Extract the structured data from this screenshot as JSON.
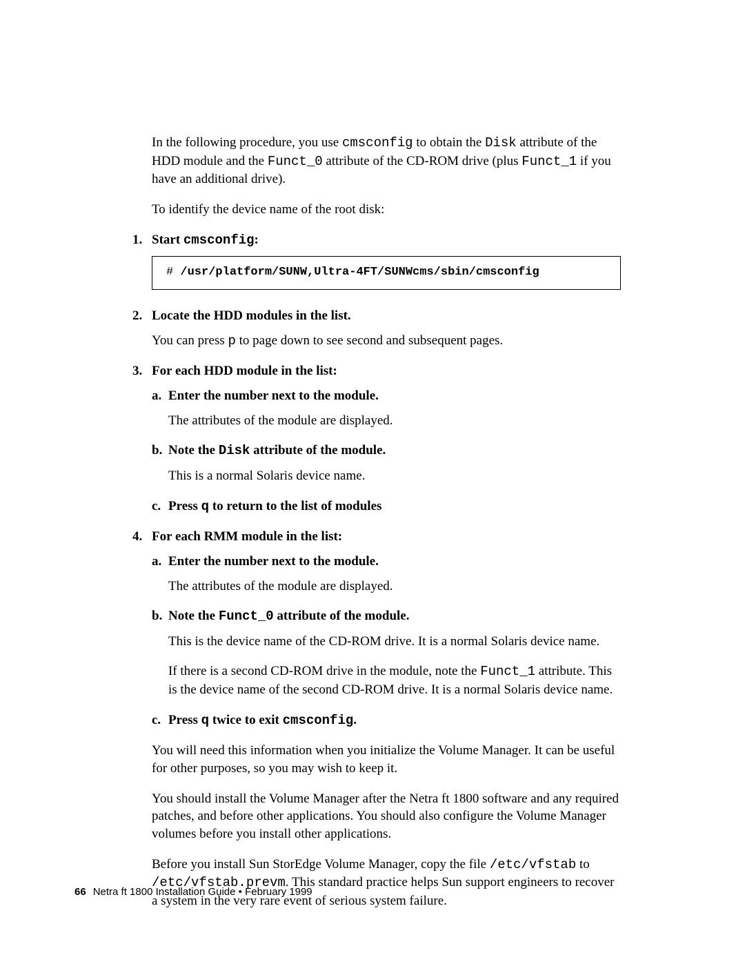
{
  "intro": {
    "p1a": "In the following procedure, you use ",
    "p1_code1": "cmsconfig",
    "p1b": " to obtain the ",
    "p1_code2": "Disk",
    "p1c": " attribute of the HDD module and the ",
    "p1_code3": "Funct_0",
    "p1d": " attribute of the CD-ROM drive (plus ",
    "p1_code4": "Funct_1",
    "p1e": " if you have an additional drive).",
    "p2": "To identify the device name of the root disk:"
  },
  "step1": {
    "num": "1.",
    "label_a": "Start ",
    "label_code": "cmsconfig",
    "label_b": ":"
  },
  "codebox": {
    "prompt": "# ",
    "cmd": "/usr/platform/SUNW,Ultra-4FT/SUNWcms/sbin/cmsconfig"
  },
  "step2": {
    "num": "2.",
    "label": "Locate the HDD modules in the list.",
    "p_a": "You can press ",
    "p_code": "p",
    "p_b": " to page down to see second and subsequent pages."
  },
  "step3": {
    "num": "3.",
    "label": "For each HDD module in the list:",
    "a": {
      "num": "a.",
      "label": "Enter the number next to the module.",
      "p": "The attributes of the module are displayed."
    },
    "b": {
      "num": "b.",
      "label_a": "Note the ",
      "label_code": "Disk",
      "label_b": " attribute of the module.",
      "p": "This is a normal Solaris device name."
    },
    "c": {
      "num": "c.",
      "label_a": "Press ",
      "label_code": "q",
      "label_b": " to return to the list of modules"
    }
  },
  "step4": {
    "num": "4.",
    "label": "For each RMM module in the list:",
    "a": {
      "num": "a.",
      "label": "Enter the number next to the module.",
      "p": "The attributes of the module are displayed."
    },
    "b": {
      "num": "b.",
      "label_a": "Note the ",
      "label_code": "Funct_0",
      "label_b": " attribute of the module.",
      "p1": "This is the device name of the CD-ROM drive. It is a normal Solaris device name.",
      "p2_a": "If there is a second CD-ROM drive in the module, note the ",
      "p2_code": "Funct_1",
      "p2_b": " attribute. This is the device name of the second CD-ROM drive. It is a normal Solaris device name."
    },
    "c": {
      "num": "c.",
      "label_a": "Press ",
      "label_code1": "q",
      "label_b": " twice to exit ",
      "label_code2": "cmsconfig",
      "label_c": "."
    }
  },
  "closing": {
    "p1": "You will need this information when you initialize the Volume Manager. It can be useful for other purposes, so you may wish to keep it.",
    "p2": "You should install the Volume Manager after the Netra ft 1800 software and any required patches, and before other applications. You should also configure the Volume Manager volumes before you install other applications.",
    "p3_a": "Before you install Sun StorEdge Volume Manager, copy the file ",
    "p3_code1": "/etc/vfstab",
    "p3_b": " to ",
    "p3_code2": "/etc/vfstab.prevm",
    "p3_c": ". This standard practice helps Sun support engineers to recover a system in the very rare event of serious system failure."
  },
  "footer": {
    "page": "66",
    "title": "Netra ft 1800 Installation Guide • February 1999"
  }
}
